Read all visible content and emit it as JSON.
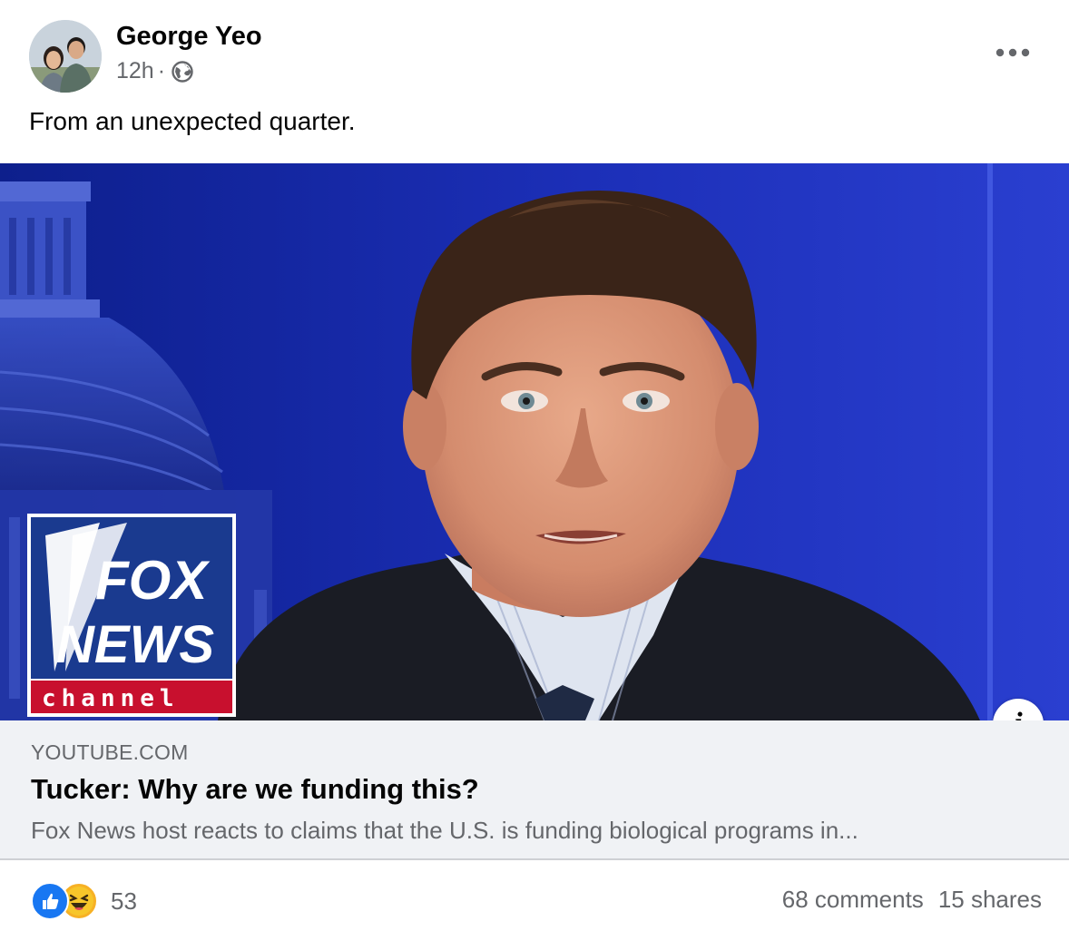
{
  "post": {
    "author": "George Yeo",
    "time": "12h",
    "separator": "·",
    "privacy_icon": "globe-icon",
    "text": "From an unexpected quarter."
  },
  "link": {
    "domain": "YOUTUBE.COM",
    "title": "Tucker: Why are we funding this?",
    "description": "Fox News host reacts to claims that the U.S. is funding biological programs in...",
    "info_glyph": "i",
    "logo": {
      "line1": "FOX",
      "line2": "NEWS",
      "line3": "channel"
    }
  },
  "footer": {
    "reactions": [
      "like-icon",
      "haha-icon"
    ],
    "reaction_count": "53",
    "comments": "68 comments",
    "shares": "15 shares"
  },
  "colors": {
    "accent": "#1877f2",
    "secondary_text": "#65676b",
    "link_bg": "#f0f2f5",
    "fox_blue": "#1a3a8f",
    "fox_red": "#c8102e"
  }
}
